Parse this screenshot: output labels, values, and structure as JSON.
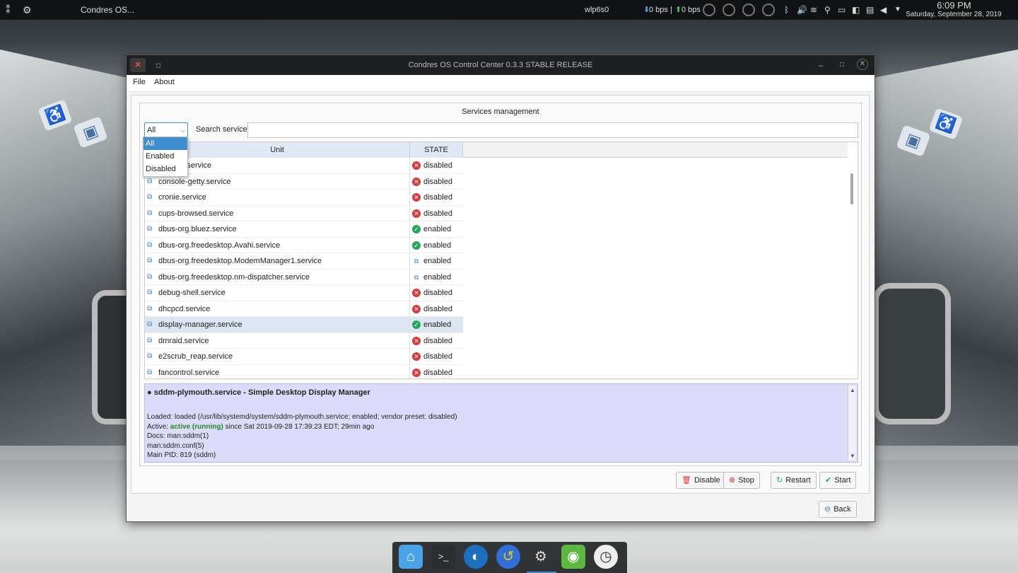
{
  "topbar": {
    "app_name": "Condres OS...",
    "network": "wlp6s0",
    "down_rate": "0 bps",
    "separator": "|",
    "up_rate": "0 bps",
    "time": "6:09 PM",
    "date": "Saturday, September 28, 2019"
  },
  "window": {
    "title": "Condres OS Control Center 0.3.3 STABLE RELEASE",
    "menu": [
      "File",
      "About"
    ]
  },
  "services": {
    "group_title": "Services management",
    "filter_value": "All",
    "filter_options": [
      "All",
      "Enabled",
      "Disabled"
    ],
    "search_label": "Search service",
    "col_unit": "Unit",
    "col_state": "STATE",
    "rows": [
      {
        "unit": "...mirror.service",
        "state": "disabled",
        "kind": "dis"
      },
      {
        "unit": "console-getty.service",
        "state": "disabled",
        "kind": "dis"
      },
      {
        "unit": "cronie.service",
        "state": "disabled",
        "kind": "dis"
      },
      {
        "unit": "cups-browsed.service",
        "state": "disabled",
        "kind": "dis"
      },
      {
        "unit": "dbus-org.bluez.service",
        "state": "enabled",
        "kind": "en"
      },
      {
        "unit": "dbus-org.freedesktop.Avahi.service",
        "state": "enabled",
        "kind": "en"
      },
      {
        "unit": "dbus-org.freedesktop.ModemManager1.service",
        "state": "enabled",
        "kind": "svc"
      },
      {
        "unit": "dbus-org.freedesktop.nm-dispatcher.service",
        "state": "enabled",
        "kind": "svc"
      },
      {
        "unit": "debug-shell.service",
        "state": "disabled",
        "kind": "dis"
      },
      {
        "unit": "dhcpcd.service",
        "state": "disabled",
        "kind": "dis"
      },
      {
        "unit": "display-manager.service",
        "state": "enabled",
        "kind": "en",
        "selected": true
      },
      {
        "unit": "dmraid.service",
        "state": "disabled",
        "kind": "dis"
      },
      {
        "unit": "e2scrub_reap.service",
        "state": "disabled",
        "kind": "dis"
      },
      {
        "unit": "fancontrol.service",
        "state": "disabled",
        "kind": "dis"
      }
    ]
  },
  "details": {
    "heading": "● sddm-plymouth.service - Simple Desktop Display Manager",
    "loaded": "Loaded: loaded (/usr/lib/systemd/system/sddm-plymouth.service; enabled; vendor preset: disabled)",
    "active_label": "Active: ",
    "active_value": "active (running)",
    "active_rest": " since Sat 2019-09-28 17:39:23 EDT; 29min ago",
    "docs1": "Docs: man:sddm(1)",
    "docs2": "man:sddm.conf(5)",
    "main_pid": "Main PID: 819 (sddm)"
  },
  "buttons": {
    "disable": "Disable",
    "stop": "Stop",
    "restart": "Restart",
    "start": "Start",
    "back": "Back"
  },
  "colors": {
    "accent": "#3e8ed0",
    "enabled": "#26a65b",
    "disabled": "#d9393b",
    "details_bg": "#dcdcfa"
  }
}
